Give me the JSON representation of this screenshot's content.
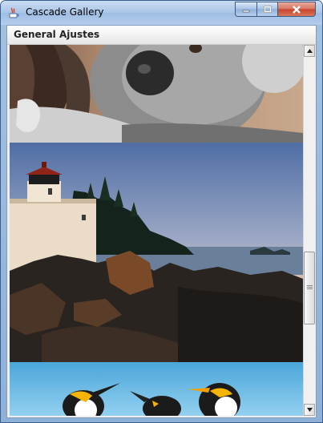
{
  "window": {
    "title": "Cascade Gallery",
    "app_icon": "java-icon",
    "controls": {
      "minimize": "minimize-icon",
      "maximize": "maximize-icon",
      "close": "close-icon"
    }
  },
  "menubar": {
    "items": [
      {
        "label": "General"
      },
      {
        "label": "Ajustes"
      }
    ]
  },
  "gallery": {
    "images": [
      {
        "subject": "koala"
      },
      {
        "subject": "lighthouse"
      },
      {
        "subject": "penguins"
      }
    ]
  },
  "scrollbar": {
    "position_fraction": 0.56,
    "visible_fraction": 0.18
  }
}
